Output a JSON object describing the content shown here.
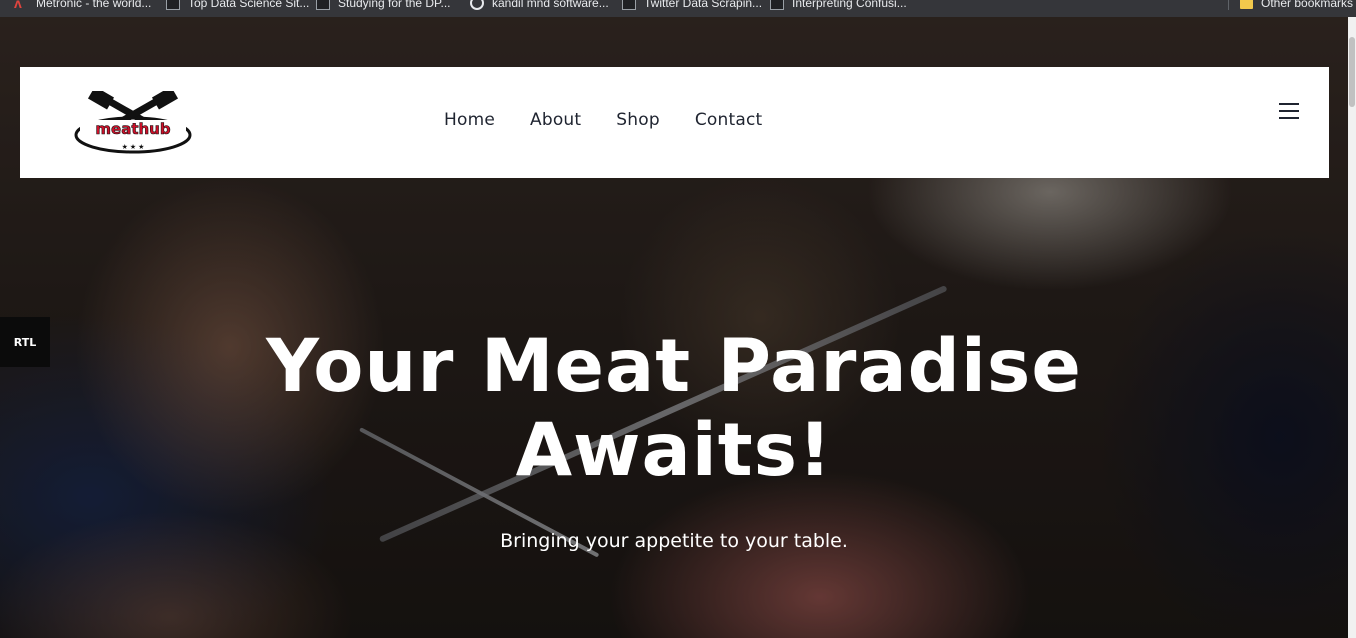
{
  "browser": {
    "bookmarks": [
      {
        "label": "Metronic - the world...",
        "icon": "metronic-icon"
      },
      {
        "label": "Top Data Science Sit...",
        "icon": "site-icon"
      },
      {
        "label": "Studying for the DP...",
        "icon": "site-icon"
      },
      {
        "label": "kandil mnd software...",
        "icon": "globe-icon"
      },
      {
        "label": "Twitter Data Scrapin...",
        "icon": "site-icon"
      },
      {
        "label": "Interpreting Confusi...",
        "icon": "site-icon"
      }
    ],
    "other_bookmarks": "Other bookmarks"
  },
  "header": {
    "logo_text": "meathub",
    "nav": [
      "Home",
      "About",
      "Shop",
      "Contact"
    ]
  },
  "rtl_label": "RTL",
  "hero": {
    "title_line1": "Your Meat Paradise",
    "title_line2": "Awaits!",
    "subtitle": "Bringing your appetite to your table."
  },
  "colors": {
    "accent": "#d0102a",
    "text_dark": "#1f2430",
    "header_bg": "#ffffff"
  }
}
